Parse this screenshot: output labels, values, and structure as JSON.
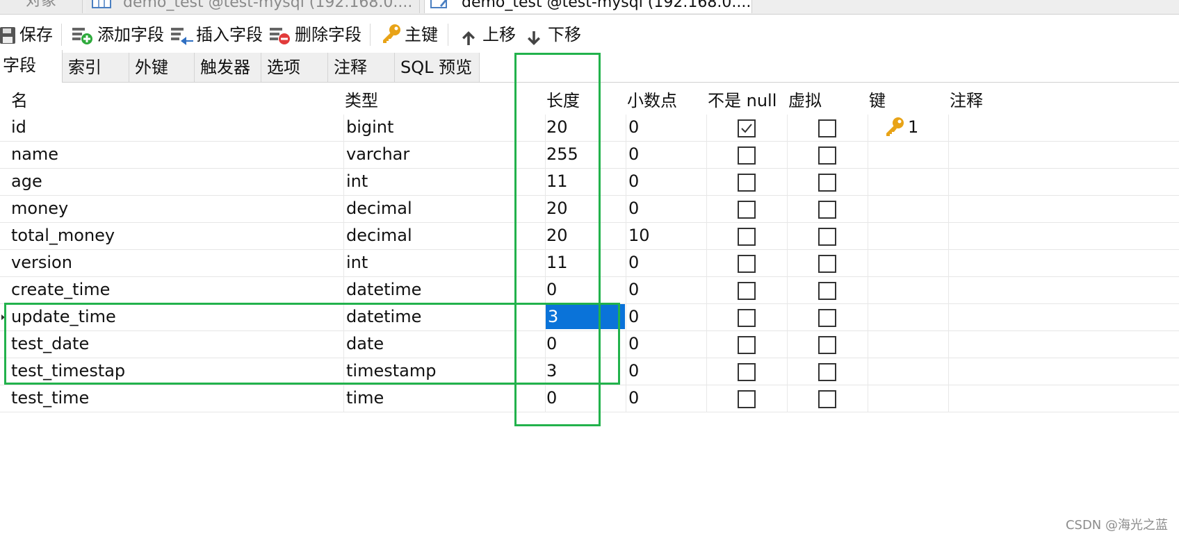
{
  "window_tabs": [
    {
      "label": "对象"
    },
    {
      "label": "demo_test @test-mysql (192.168.0...."
    },
    {
      "label": "demo_test @test-mysql (192.168.0...."
    }
  ],
  "toolbar": {
    "save": "保存",
    "add_field": "添加字段",
    "insert_field": "插入字段",
    "delete_field": "删除字段",
    "primary_key": "主键",
    "move_up": "上移",
    "move_down": "下移"
  },
  "subtabs": [
    "字段",
    "索引",
    "外键",
    "触发器",
    "选项",
    "注释",
    "SQL 预览"
  ],
  "columns": {
    "name": "名",
    "type": "类型",
    "length": "长度",
    "decimals": "小数点",
    "not_null": "不是 null",
    "virtual": "虚拟",
    "key": "键",
    "comment": "注释"
  },
  "rows": [
    {
      "name": "id",
      "type": "bigint",
      "length": "20",
      "decimals": "0",
      "not_null": true,
      "virtual": false,
      "key": "1"
    },
    {
      "name": "name",
      "type": "varchar",
      "length": "255",
      "decimals": "0",
      "not_null": false,
      "virtual": false,
      "key": ""
    },
    {
      "name": "age",
      "type": "int",
      "length": "11",
      "decimals": "0",
      "not_null": false,
      "virtual": false,
      "key": ""
    },
    {
      "name": "money",
      "type": "decimal",
      "length": "20",
      "decimals": "0",
      "not_null": false,
      "virtual": false,
      "key": ""
    },
    {
      "name": "total_money",
      "type": "decimal",
      "length": "20",
      "decimals": "10",
      "not_null": false,
      "virtual": false,
      "key": ""
    },
    {
      "name": "version",
      "type": "int",
      "length": "11",
      "decimals": "0",
      "not_null": false,
      "virtual": false,
      "key": ""
    },
    {
      "name": "create_time",
      "type": "datetime",
      "length": "0",
      "decimals": "0",
      "not_null": false,
      "virtual": false,
      "key": ""
    },
    {
      "name": "update_time",
      "type": "datetime",
      "length": "3",
      "decimals": "0",
      "not_null": false,
      "virtual": false,
      "key": ""
    },
    {
      "name": "test_date",
      "type": "date",
      "length": "0",
      "decimals": "0",
      "not_null": false,
      "virtual": false,
      "key": ""
    },
    {
      "name": "test_timestap",
      "type": "timestamp",
      "length": "3",
      "decimals": "0",
      "not_null": false,
      "virtual": false,
      "key": ""
    },
    {
      "name": "test_time",
      "type": "time",
      "length": "0",
      "decimals": "0",
      "not_null": false,
      "virtual": false,
      "key": ""
    }
  ],
  "selected_row": 7,
  "colors": {
    "selection": "#0a73d9",
    "annotation": "#22b24c",
    "key_icon": "#e8a317"
  },
  "icons": {
    "save": "save-icon",
    "add": "add-field-icon",
    "insert": "insert-field-icon",
    "delete": "delete-field-icon",
    "key": "key-icon",
    "up": "arrow-up-icon",
    "down": "arrow-down-icon"
  },
  "watermark": "CSDN @海光之蓝"
}
